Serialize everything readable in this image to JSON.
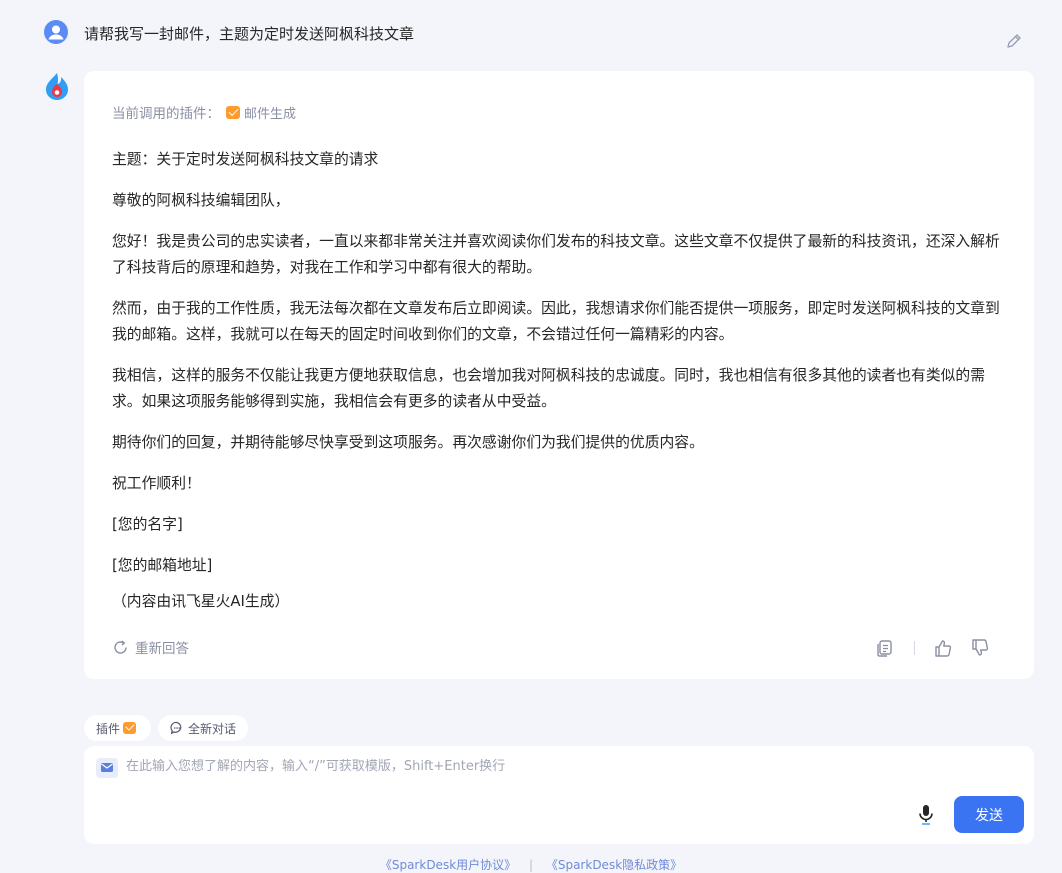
{
  "conversation": {
    "user_message": "请帮我写一封邮件，主题为定时发送阿枫科技文章",
    "answer": {
      "plugin_prefix": "当前调用的插件：",
      "plugin_name": "邮件生成",
      "paragraphs": [
        "主题：关于定时发送阿枫科技文章的请求",
        "尊敬的阿枫科技编辑团队，",
        "您好！我是贵公司的忠实读者，一直以来都非常关注并喜欢阅读你们发布的科技文章。这些文章不仅提供了最新的科技资讯，还深入解析了科技背后的原理和趋势，对我在工作和学习中都有很大的帮助。",
        "然而，由于我的工作性质，我无法每次都在文章发布后立即阅读。因此，我想请求你们能否提供一项服务，即定时发送阿枫科技的文章到我的邮箱。这样，我就可以在每天的固定时间收到你们的文章，不会错过任何一篇精彩的内容。",
        "我相信，这样的服务不仅能让我更方便地获取信息，也会增加我对阿枫科技的忠诚度。同时，我也相信有很多其他的读者也有类似的需求。如果这项服务能够得到实施，我相信会有更多的读者从中受益。",
        "期待你们的回复，并期待能够尽快享受到这项服务。再次感谢你们为我们提供的优质内容。",
        "祝工作顺利！",
        "[您的名字]",
        "[您的邮箱地址]",
        "（内容由讯飞星火AI生成）"
      ],
      "regenerate_label": "重新回答"
    }
  },
  "toolbar": {
    "plugins_label": "插件",
    "new_chat_label": "全新对话"
  },
  "composer": {
    "placeholder": "在此输入您想了解的内容，输入“/”可获取模版，Shift+Enter换行",
    "send_label": "发送"
  },
  "footer": {
    "user_agreement": "《SparkDesk用户协议》",
    "divider": "|",
    "privacy_policy": "《SparkDesk隐私政策》"
  },
  "colors": {
    "accent": "#3a74f2",
    "plugin_badge": "#ff9a2e",
    "page_bg": "#f3f5fa"
  },
  "icons": {
    "user_avatar": "user-avatar-icon",
    "bot_avatar": "spark-logo-icon",
    "edit": "pencil-icon",
    "regenerate": "refresh-icon",
    "copy": "copy-icon",
    "like": "thumbs-up-icon",
    "dislike": "thumbs-down-icon",
    "mic": "microphone-icon"
  }
}
